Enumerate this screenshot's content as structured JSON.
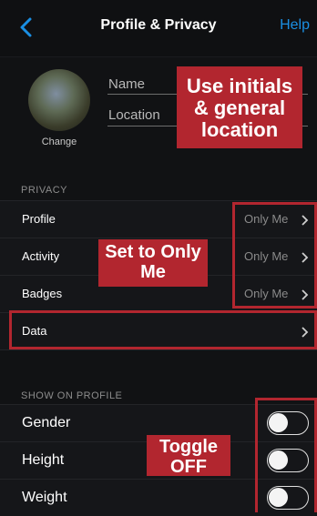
{
  "header": {
    "title": "Profile & Privacy",
    "help": "Help"
  },
  "profile": {
    "change": "Change",
    "name_placeholder": "Name",
    "location_placeholder": "Location"
  },
  "callouts": {
    "initials": "Use initials & general location",
    "only_me": "Set to Only Me",
    "toggle_off": "Toggle OFF"
  },
  "privacy": {
    "section_label": "PRIVACY",
    "rows": [
      {
        "label": "Profile",
        "value": "Only Me"
      },
      {
        "label": "Activity",
        "value": "Only Me"
      },
      {
        "label": "Badges",
        "value": "Only Me"
      },
      {
        "label": "Data",
        "value": ""
      }
    ]
  },
  "show_on_profile": {
    "section_label": "SHOW ON PROFILE",
    "toggles": [
      {
        "label": "Gender",
        "on": false
      },
      {
        "label": "Height",
        "on": false
      },
      {
        "label": "Weight",
        "on": false
      }
    ]
  },
  "colors": {
    "accent": "#1a8fe3",
    "callout": "#b2262f"
  }
}
